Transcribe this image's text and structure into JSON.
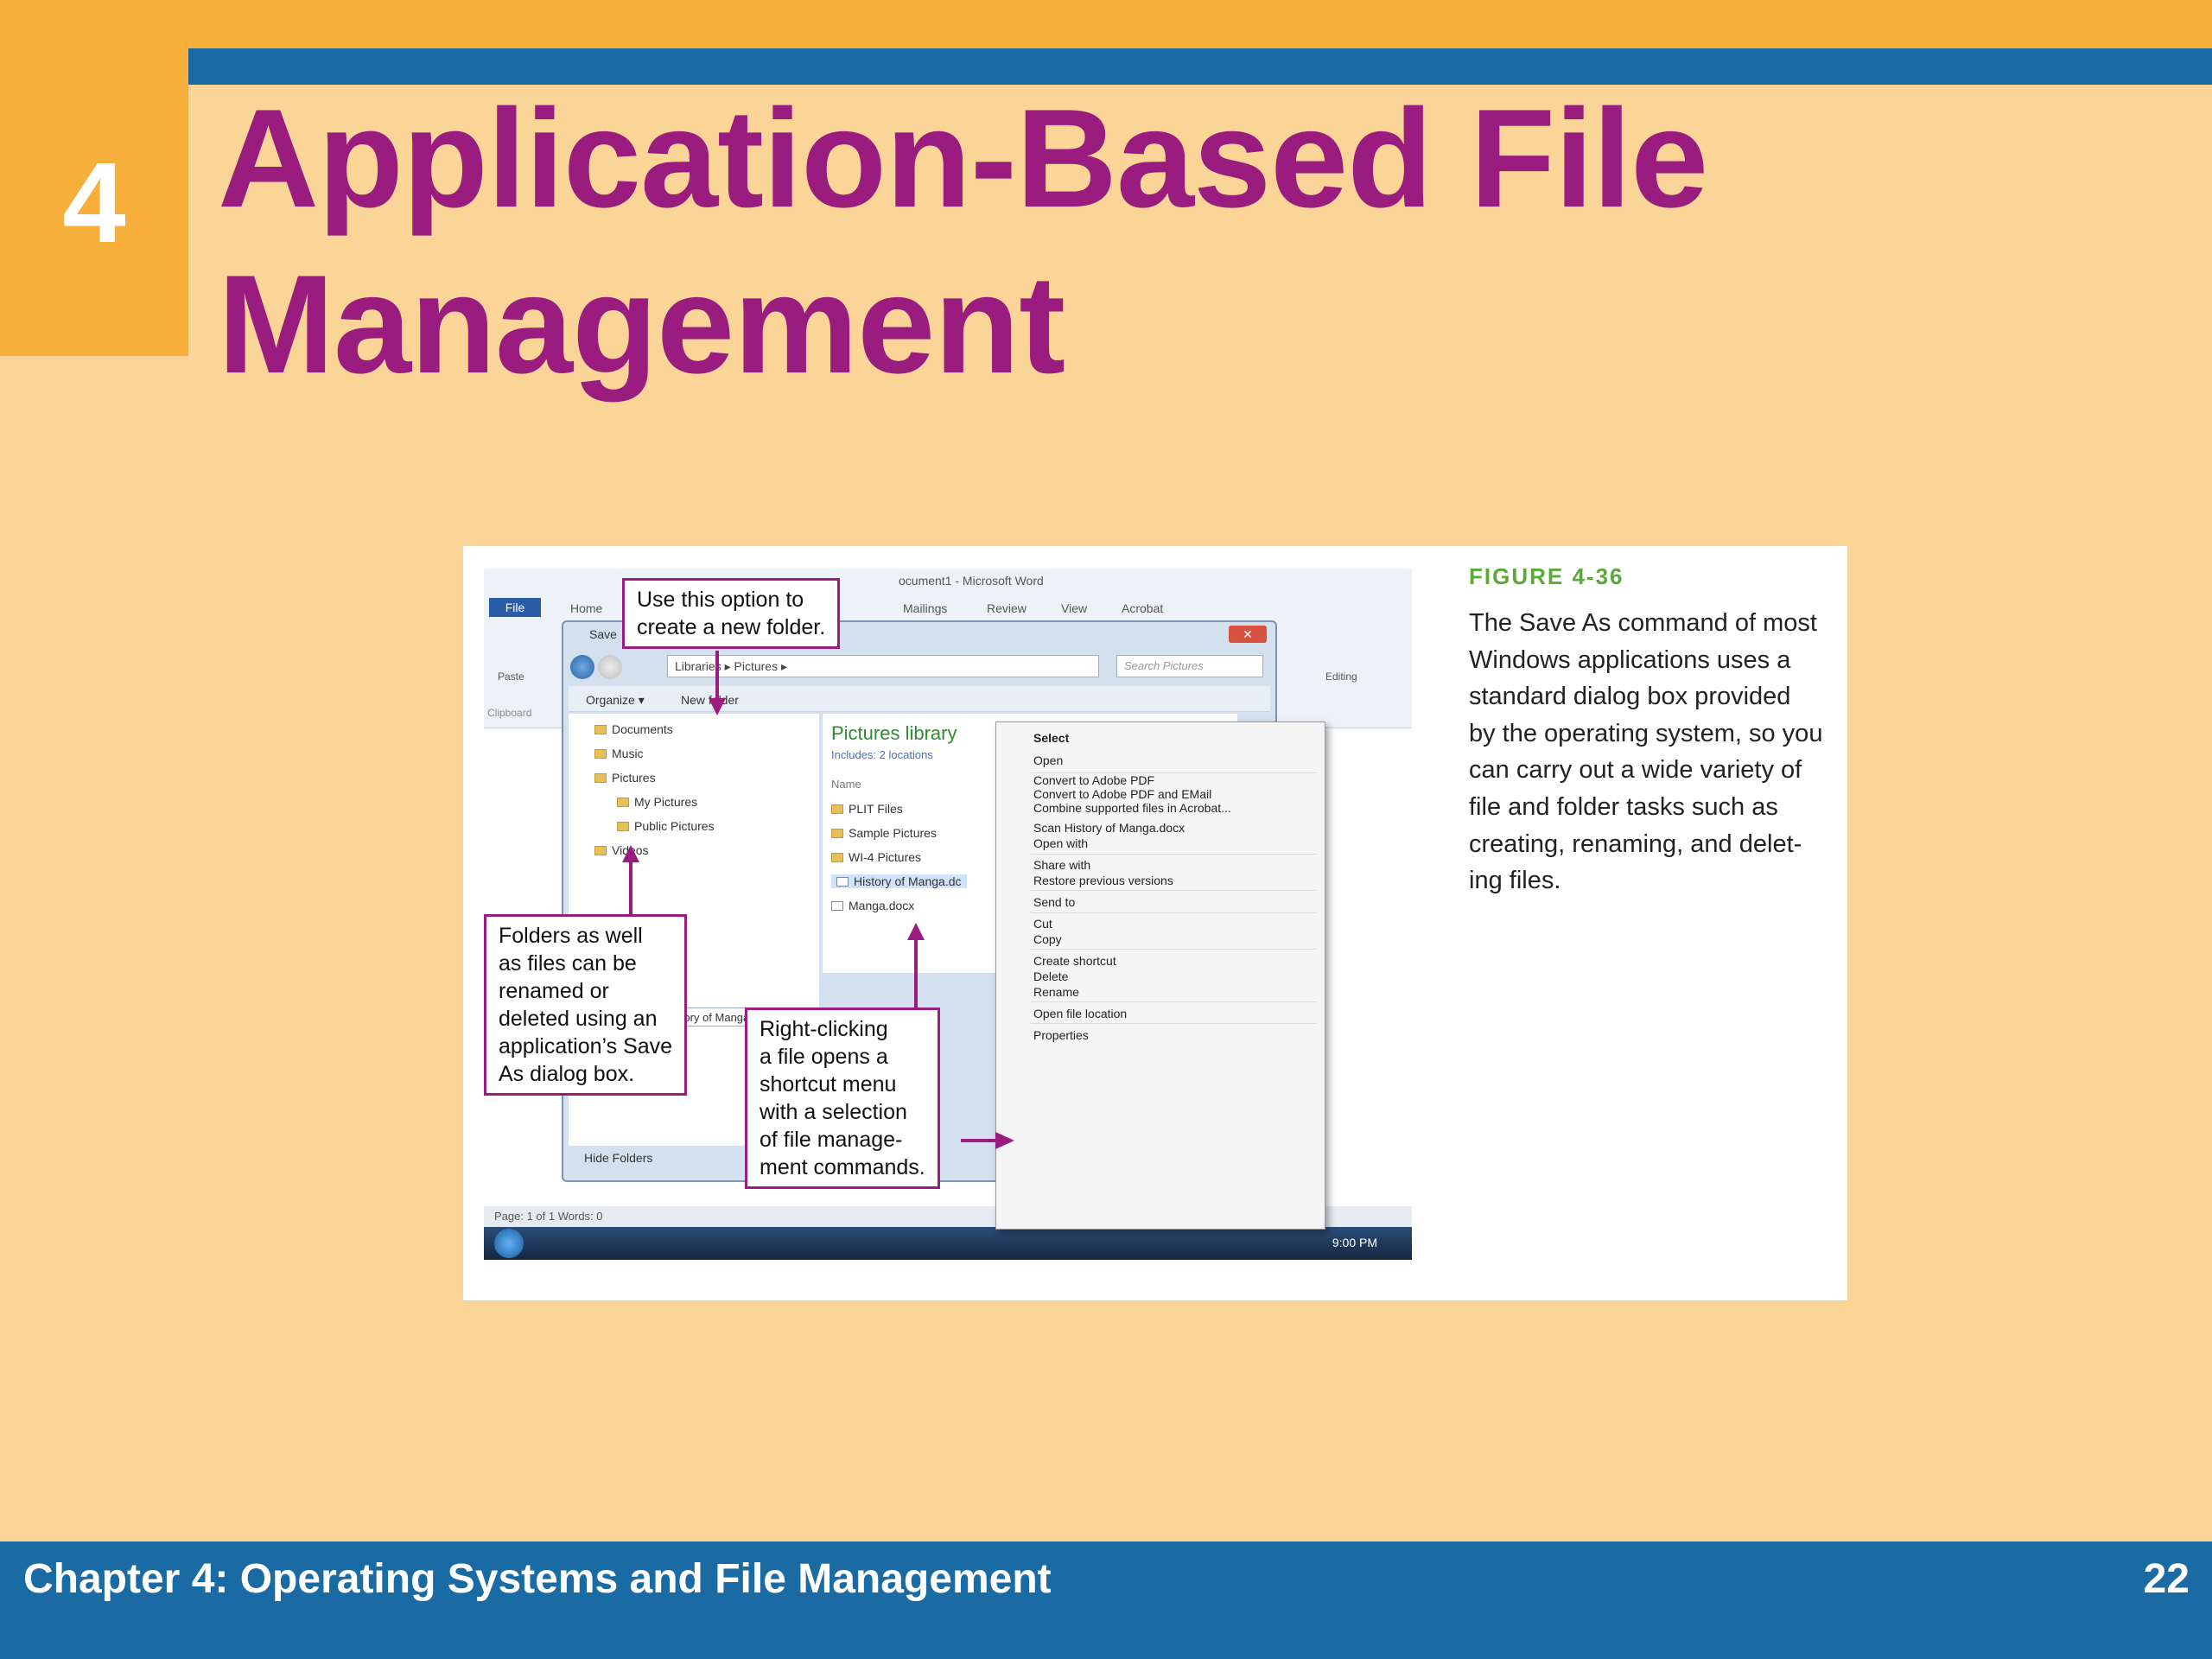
{
  "slide": {
    "chapter_number": "4",
    "title_lines": [
      "Application-Based File",
      "Management"
    ],
    "footer_text": "Chapter 4: Operating Systems and File Management",
    "page_number": "22"
  },
  "figure": {
    "label": "FIGURE 4-36",
    "caption_lines": [
      "The Save As command of most",
      "Windows applications uses a",
      "standard dialog box provided",
      "by the operating system, so you",
      "can carry out a wide variety of",
      "file and folder tasks such as",
      "creating, renaming, and delet-",
      "ing files."
    ]
  },
  "screenshot": {
    "word": {
      "window_title": "ocument1 - Microsoft Word",
      "tabs": [
        "File",
        "Home",
        "Mailings",
        "Review",
        "View",
        "Acrobat"
      ],
      "group_labels": [
        "Paste",
        "Clipboard",
        "Editing"
      ],
      "status_text": "Page: 1 of 1    Words: 0",
      "clock": "9:00 PM"
    },
    "dialog": {
      "title_fragment": "Save",
      "address_path": "Libraries  ▸  Pictures  ▸",
      "search_placeholder": "Search Pictures",
      "organize_label": "Organize ▾",
      "new_folder_label": "New folder",
      "nav_items": [
        "Documents",
        "Music",
        "Pictures",
        "My Pictures",
        "Public Pictures",
        "Videos"
      ],
      "library_title": "Pictures library",
      "library_includes": "Includes:  2 locations",
      "column_header": "Name",
      "files": [
        "PLIT Files",
        "Sample Pictures",
        "WI-4 Pictures",
        "History of Manga.dc",
        "Manga.docx"
      ],
      "file_name_value": "History of Manga.docx",
      "hide_folders_label": "Hide Folders"
    },
    "context_menu": {
      "items": [
        "Select",
        "Open",
        "Convert to Adobe PDF",
        "Convert to Adobe PDF and EMail",
        "Combine supported files in Acrobat...",
        "Scan History of Manga.docx",
        "Open with",
        "Share with",
        "Restore previous versions",
        "Send to",
        "Cut",
        "Copy",
        "Create shortcut",
        "Delete",
        "Rename",
        "Open file location",
        "Properties"
      ]
    },
    "callouts": {
      "new_folder": [
        "Use this option to",
        "create a new folder."
      ],
      "folders": [
        "Folders as well",
        "as files can be",
        "renamed or",
        "deleted using an",
        "application’s Save",
        "As dialog box."
      ],
      "right_click": [
        "Right-clicking",
        "a file opens a",
        "shortcut menu",
        "with a selection",
        "of file manage-",
        "ment commands."
      ]
    }
  },
  "colors": {
    "background": "#fbd497",
    "orange": "#f8ae3b",
    "blue": "#1a6aa4",
    "title_purple": "#9a1c7f",
    "figure_green": "#5aaa3a"
  }
}
